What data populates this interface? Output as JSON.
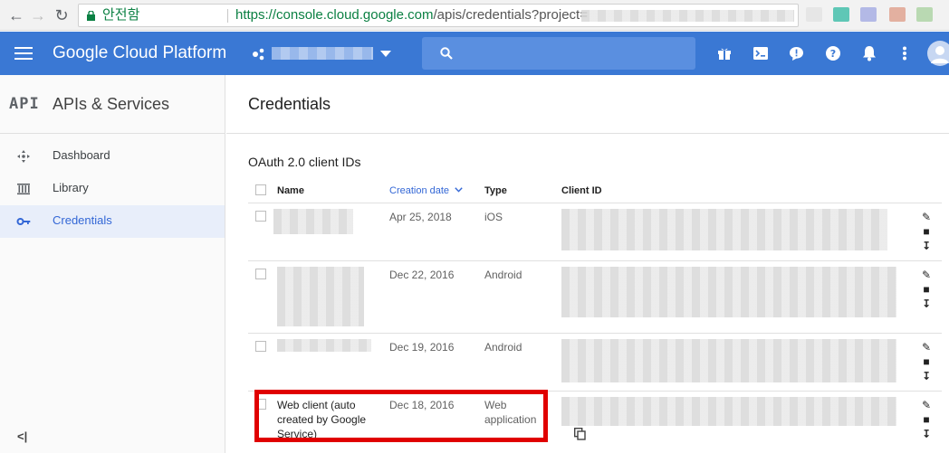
{
  "browser": {
    "secure_label": "안전함",
    "url_host": "https://console.cloud.google.com",
    "url_path": "/apis/credentials?project="
  },
  "header": {
    "product_name": "Google Cloud Platform"
  },
  "sidebar": {
    "logo_text": "API",
    "title": "APIs & Services",
    "items": [
      {
        "label": "Dashboard",
        "icon": "dashboard-icon"
      },
      {
        "label": "Library",
        "icon": "library-icon"
      },
      {
        "label": "Credentials",
        "icon": "key-icon"
      }
    ],
    "collapse_glyph": "<|"
  },
  "main": {
    "page_title": "Credentials",
    "section_title": "OAuth 2.0 client IDs",
    "columns": {
      "name": "Name",
      "creation_date": "Creation date",
      "type": "Type",
      "client_id": "Client ID"
    },
    "rows": [
      {
        "name": "",
        "date": "Apr 25, 2018",
        "type": "iOS"
      },
      {
        "name": "",
        "date": "Dec 22, 2016",
        "type": "Android"
      },
      {
        "name": "",
        "date": "Dec 19, 2016",
        "type": "Android"
      },
      {
        "name_lines": [
          "Web client (auto",
          "created by Google",
          "Service)"
        ],
        "date": "Dec 18, 2016",
        "type_lines": [
          "Web",
          "application"
        ]
      }
    ]
  },
  "colors": {
    "header_bg": "#3a78d4",
    "accent": "#3367d6",
    "highlight_box": "#e00000"
  }
}
